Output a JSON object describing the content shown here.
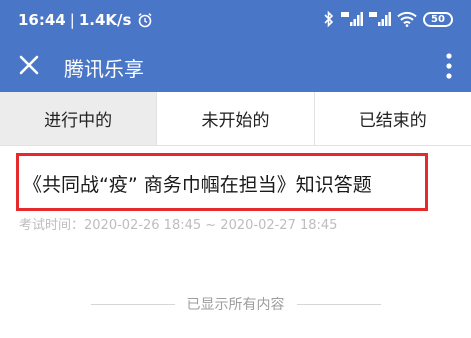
{
  "status_bar": {
    "time": "16:44",
    "separator": "|",
    "speed": "1.4K/s",
    "battery": "50"
  },
  "app_bar": {
    "title": "腾讯乐享"
  },
  "tabs": [
    {
      "label": "进行中的",
      "active": true
    },
    {
      "label": "未开始的",
      "active": false
    },
    {
      "label": "已结束的",
      "active": false
    }
  ],
  "list": [
    {
      "title": "《共同战“疫” 商务巾帼在担当》知识答题",
      "time": "考试时间：2020-02-26 18:45 ~ 2020-02-27 18:45"
    }
  ],
  "footer": {
    "end_text": "已显示所有内容"
  },
  "colors": {
    "header_blue": "#4a76c8",
    "highlight_red": "#e5292c"
  }
}
